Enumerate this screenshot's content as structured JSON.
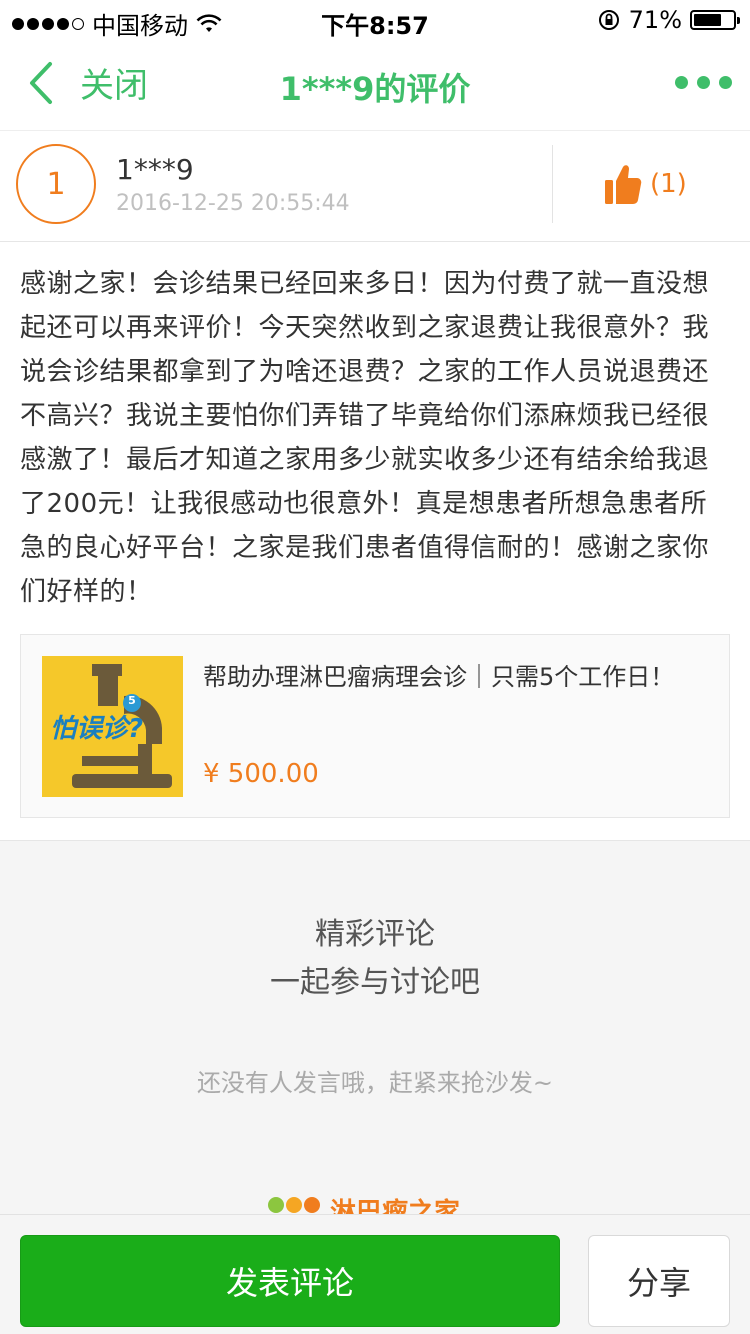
{
  "status_bar": {
    "carrier": "中国移动",
    "time": "下午8:57",
    "battery": "71%",
    "battery_level": 0.71
  },
  "nav": {
    "close_label": "关闭",
    "title": "1***9的评价"
  },
  "review": {
    "avatar_text": "1",
    "reviewer": "1***9",
    "date": "2016-12-25 20:55:44",
    "like_count": "(1)",
    "body": "感谢之家！会诊结果已经回来多日！因为付费了就一直没想起还可以再来评价！今天突然收到之家退费让我很意外？我说会诊结果都拿到了为啥还退费？之家的工作人员说退费还不高兴？我说主要怕你们弄错了毕竟给你们添麻烦我已经很感激了！最后才知道之家用多少就实收多少还有结余给我退了200元！让我很感动也很意外！真是想患者所想急患者所急的良心好平台！之家是我们患者值得信耐的！感谢之家你们好样的！"
  },
  "product": {
    "thumb_text": "怕误诊?",
    "thumb_badge": "5",
    "title": "帮助办理淋巴瘤病理会诊｜只需5个工作日！",
    "price": "¥ 500.00"
  },
  "comments": {
    "title_line1": "精彩评论",
    "title_line2": "一起参与讨论吧",
    "empty_text": "还没有人发言哦，赶紧来抢沙发~",
    "brand_name": "淋巴瘤之家"
  },
  "bottom_bar": {
    "comment_label": "发表评论",
    "share_label": "分享"
  },
  "colors": {
    "accent_green": "#3fbe6a",
    "button_green": "#1aad19",
    "orange": "#f07d1e"
  }
}
